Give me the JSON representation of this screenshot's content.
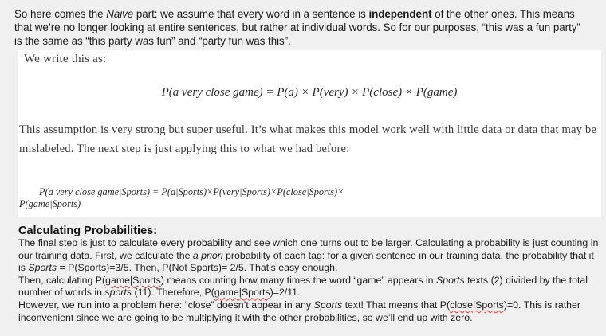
{
  "intro": {
    "t1": "So here comes the ",
    "t2": "Naive",
    "t3": " part: we assume that every word in a sentence is ",
    "t4": "independent",
    "t5": " of the other ones. This means that we’re no longer looking at entire sentences, but rather at individual words. So for our purposes, “this was a fun party” is the same as “this party was fun” and “party fun was this”."
  },
  "card": {
    "lead": "We write this as:",
    "equation1": "P(a very close game) = P(a) × P(very) × P(close) × P(game)",
    "assumption": "This assumption is very strong but super useful. It’s what makes this model work well with little data or data that may be mislabeled. The next step is just applying this to what we had before:",
    "equation2_line1": "P(a very close game|Sports) = P(a|Sports)×P(very|Sports)×P(close|Sports)×",
    "equation2_line2": "P(game|Sports)"
  },
  "section": {
    "title": "Calculating Probabilities:",
    "p1_a": "The final step is just to calculate every probability and see which one turns out to be larger. Calculating a probability is just counting in our training data. First, we calculate the ",
    "p1_b": "a priori",
    "p1_c": " probability of each tag: for a given sentence in our training data, the probability that it is ",
    "p1_d": "Sports",
    "p1_e": " = P(Sports)=3/5. Then, P(Not Sports)= 2/5. That’s easy enough.",
    "p2_a": "Then, calculating  P(",
    "p2_b": "game|Sports",
    "p2_c": ")  means counting how many times the word “game” appears in ",
    "p2_d": "Sports",
    "p2_e": " texts (2) divided by the total number of words in ",
    "p2_f": "sports",
    "p2_g": " (11). Therefore, P(",
    "p2_h": "game|Sports",
    "p2_i": ")=2/11.",
    "p3_a": "However, we run into a problem here: “close” doesn’t appear in any ",
    "p3_b": "Sports",
    "p3_c": " text! That means that P(",
    "p3_d": "close|Sports",
    "p3_e": ")=0. This is rather inconvenient since we are going to be multiplying it with the other probabilities, so we’ll end up with zero."
  }
}
